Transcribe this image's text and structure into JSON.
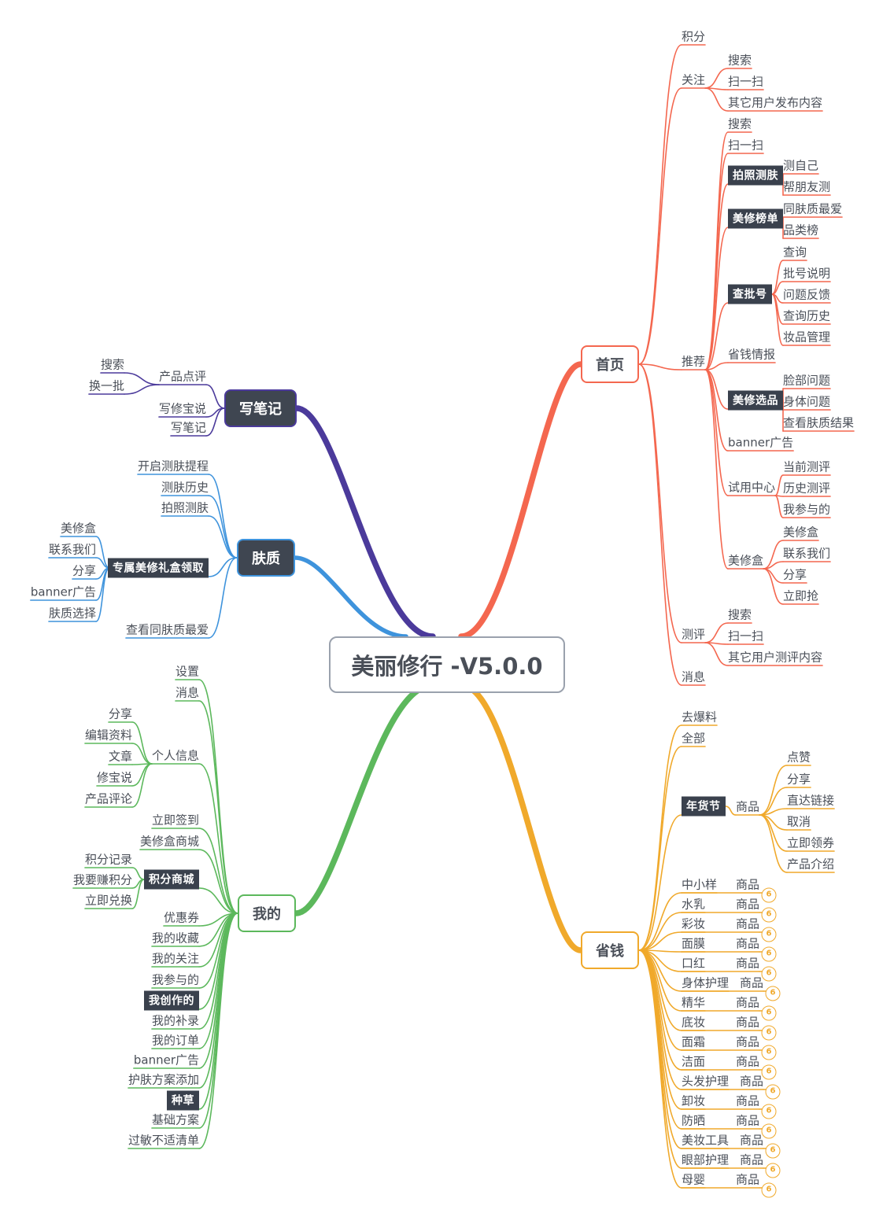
{
  "root": {
    "label": "美丽修行 -V5.0.0"
  },
  "colors": {
    "home": "#F4674F",
    "note": "#4B3A9B",
    "skin": "#3E93DC",
    "mine": "#5CB85C",
    "save": "#F0A92B",
    "root_border": "#9AA1AD",
    "badge_bg": "#3A414D",
    "node_dark": "#3F4651",
    "text": "#4A4F58"
  },
  "branches": {
    "home": {
      "label": "首页",
      "children": [
        {
          "label": "积分",
          "children": []
        },
        {
          "label": "关注",
          "children": [
            {
              "label": "搜索"
            },
            {
              "label": "扫一扫"
            },
            {
              "label": "其它用户发布内容"
            }
          ]
        },
        {
          "label": "推荐",
          "children": [
            {
              "label": "搜索"
            },
            {
              "label": "扫一扫"
            },
            {
              "label": "拍照测肤",
              "badge": true,
              "children": [
                {
                  "label": "测自己"
                },
                {
                  "label": "帮朋友测"
                }
              ]
            },
            {
              "label": "美修榜单",
              "badge": true,
              "children": [
                {
                  "label": "同肤质最爱"
                },
                {
                  "label": "品类榜"
                }
              ]
            },
            {
              "label": "查批号",
              "badge": true,
              "children": [
                {
                  "label": "查询"
                },
                {
                  "label": "批号说明"
                },
                {
                  "label": "问题反馈"
                },
                {
                  "label": "查询历史"
                },
                {
                  "label": "妆品管理"
                }
              ]
            },
            {
              "label": "省钱情报"
            },
            {
              "label": "美修选品",
              "badge": true,
              "children": [
                {
                  "label": "脸部问题"
                },
                {
                  "label": "身体问题"
                },
                {
                  "label": "查看肤质结果"
                }
              ]
            },
            {
              "label": "banner广告"
            },
            {
              "label": "试用中心",
              "children": [
                {
                  "label": "当前测评"
                },
                {
                  "label": "历史测评"
                },
                {
                  "label": "我参与的"
                }
              ]
            },
            {
              "label": "美修盒",
              "children": [
                {
                  "label": "美修盒"
                },
                {
                  "label": "联系我们"
                },
                {
                  "label": "分享"
                },
                {
                  "label": "立即抢"
                }
              ]
            }
          ]
        },
        {
          "label": "测评",
          "children": [
            {
              "label": "搜索"
            },
            {
              "label": "扫一扫"
            },
            {
              "label": "其它用户测评内容"
            }
          ]
        },
        {
          "label": "消息",
          "children": []
        }
      ]
    },
    "note": {
      "label": "写笔记",
      "children": [
        {
          "label": "产品点评",
          "children": [
            {
              "label": "搜索"
            },
            {
              "label": "换一批"
            }
          ]
        },
        {
          "label": "写修宝说"
        },
        {
          "label": "写笔记"
        }
      ]
    },
    "skin": {
      "label": "肤质",
      "children": [
        {
          "label": "开启测肤提程"
        },
        {
          "label": "测肤历史"
        },
        {
          "label": "拍照测肤"
        },
        {
          "label": "专属美修礼盒领取",
          "badge": true,
          "children": [
            {
              "label": "美修盒"
            },
            {
              "label": "联系我们"
            },
            {
              "label": "分享"
            },
            {
              "label": "banner广告"
            },
            {
              "label": "肤质选择"
            }
          ]
        },
        {
          "label": "查看同肤质最爱"
        }
      ]
    },
    "mine": {
      "label": "我的",
      "children": [
        {
          "label": "设置"
        },
        {
          "label": "消息"
        },
        {
          "label": "个人信息",
          "children": [
            {
              "label": "分享"
            },
            {
              "label": "编辑资料"
            },
            {
              "label": "文章"
            },
            {
              "label": "修宝说"
            },
            {
              "label": "产品评论"
            }
          ]
        },
        {
          "label": "立即签到"
        },
        {
          "label": "美修盒商城"
        },
        {
          "label": "积分商城",
          "badge": true,
          "children": [
            {
              "label": "积分记录"
            },
            {
              "label": "我要赚积分"
            },
            {
              "label": "立即兑换"
            }
          ]
        },
        {
          "label": "优惠券"
        },
        {
          "label": "我的收藏"
        },
        {
          "label": "我的关注"
        },
        {
          "label": "我参与的"
        },
        {
          "label": "我创作的",
          "badge": true
        },
        {
          "label": "我的补录"
        },
        {
          "label": "我的订单"
        },
        {
          "label": "banner广告"
        },
        {
          "label": "护肤方案添加"
        },
        {
          "label": "种草",
          "badge": true
        },
        {
          "label": "基础方案"
        },
        {
          "label": "过敏不适清单"
        }
      ]
    },
    "save": {
      "label": "省钱",
      "children": [
        {
          "label": "去爆料"
        },
        {
          "label": "全部"
        },
        {
          "label": "年货节",
          "badge": true,
          "children": [
            {
              "label": "商品",
              "children": [
                {
                  "label": "点赞"
                },
                {
                  "label": "分享"
                },
                {
                  "label": "直达链接"
                },
                {
                  "label": "取消"
                },
                {
                  "label": "立即领券"
                },
                {
                  "label": "产品介绍"
                }
              ]
            }
          ]
        },
        {
          "label": "中小样",
          "product": "商品",
          "count": "6"
        },
        {
          "label": "水乳",
          "product": "商品",
          "count": "6"
        },
        {
          "label": "彩妆",
          "product": "商品",
          "count": "6"
        },
        {
          "label": "面膜",
          "product": "商品",
          "count": "6"
        },
        {
          "label": "口红",
          "product": "商品",
          "count": "6"
        },
        {
          "label": "身体护理",
          "product": "商品",
          "count": "6"
        },
        {
          "label": "精华",
          "product": "商品",
          "count": "6"
        },
        {
          "label": "底妆",
          "product": "商品",
          "count": "6"
        },
        {
          "label": "面霜",
          "product": "商品",
          "count": "6"
        },
        {
          "label": "洁面",
          "product": "商品",
          "count": "6"
        },
        {
          "label": "头发护理",
          "product": "商品",
          "count": "6"
        },
        {
          "label": "卸妆",
          "product": "商品",
          "count": "6"
        },
        {
          "label": "防晒",
          "product": "商品",
          "count": "6"
        },
        {
          "label": "美妆工具",
          "product": "商品",
          "count": "6"
        },
        {
          "label": "眼部护理",
          "product": "商品",
          "count": "6"
        },
        {
          "label": "母婴",
          "product": "商品",
          "count": "6"
        }
      ]
    }
  }
}
